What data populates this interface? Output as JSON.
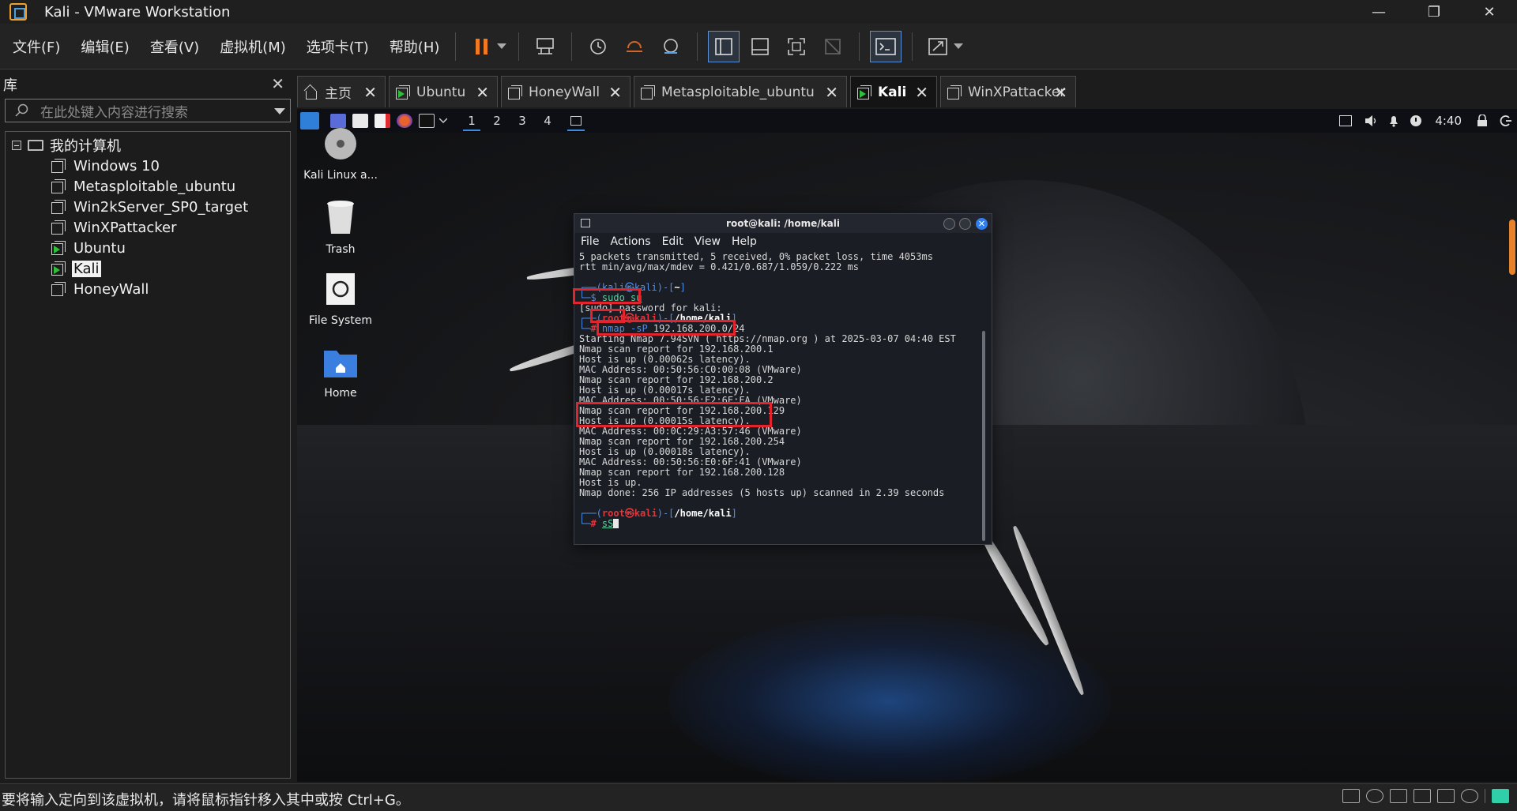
{
  "window": {
    "title": "Kali - VMware Workstation",
    "minimize": "—",
    "maximize": "❐",
    "close": "✕"
  },
  "menu": [
    "文件(F)",
    "编辑(E)",
    "查看(V)",
    "虚拟机(M)",
    "选项卡(T)",
    "帮助(H)"
  ],
  "toolbar_icons": [
    "pause-icon",
    "dropdown-arrow-icon",
    "send-ctrl-alt-del-icon",
    "snapshot-icon",
    "revert-snapshot-icon",
    "snapshot-manager-icon",
    "library-view-icon",
    "thumbnail-view-icon",
    "full-screen-icon",
    "unity-icon",
    "console-view-icon",
    "stretch-guest-icon"
  ],
  "library": {
    "title": "库",
    "close": "✕",
    "search_placeholder": "在此处键入内容进行搜索",
    "root": "我的计算机",
    "vms": [
      {
        "name": "Windows 10",
        "running": false,
        "selected": false
      },
      {
        "name": "Metasploitable_ubuntu",
        "running": false,
        "selected": false
      },
      {
        "name": "Win2kServer_SP0_target",
        "running": false,
        "selected": false
      },
      {
        "name": "WinXPattacker",
        "running": false,
        "selected": false
      },
      {
        "name": "Ubuntu",
        "running": true,
        "selected": false
      },
      {
        "name": "Kali",
        "running": true,
        "selected": true
      },
      {
        "name": "HoneyWall",
        "running": false,
        "selected": false
      }
    ]
  },
  "tabs": [
    {
      "label": "主页",
      "icon": "home-icon",
      "active": false
    },
    {
      "label": "Ubuntu",
      "icon": "vm-running-icon",
      "active": false
    },
    {
      "label": "HoneyWall",
      "icon": "vm-icon",
      "active": false
    },
    {
      "label": "Metasploitable_ubuntu",
      "icon": "vm-icon",
      "active": false
    },
    {
      "label": "Kali",
      "icon": "vm-running-icon",
      "active": true
    },
    {
      "label": "WinXPattacker",
      "icon": "vm-icon",
      "active": false
    }
  ],
  "kali_panel": {
    "workspaces": [
      "1",
      "2",
      "3",
      "4"
    ],
    "active_workspace": "1",
    "clock": "4:40"
  },
  "desktop_icons": [
    {
      "label": "Kali Linux a...",
      "icon": "disc-icon"
    },
    {
      "label": "Trash",
      "icon": "trash-icon"
    },
    {
      "label": "File System",
      "icon": "filesystem-icon"
    },
    {
      "label": "Home",
      "icon": "home-folder-icon"
    }
  ],
  "terminal": {
    "title": "root@kali: /home/kali",
    "menu": [
      "File",
      "Actions",
      "Edit",
      "View",
      "Help"
    ],
    "lines": {
      "l1": "5 packets transmitted, 5 received, 0% packet loss, time 4053ms",
      "l2": "rtt min/avg/max/mdev = 0.421/0.687/1.059/0.222 ms",
      "p1_user": "kali",
      "p1_at": "㉿",
      "p1_host": "kali",
      "p1_dir": "~",
      "cmd1": "sudo su",
      "l3": "[sudo] password for kali:",
      "p2_user": "root",
      "p2_host": "kali",
      "p2_dir": "/home/kali",
      "cmd2_a": "nmap -sP",
      "cmd2_b": " 192.168.200.0/24",
      "l4": "Starting Nmap 7.94SVN ( https://nmap.org ) at 2025-03-07 04:40 EST",
      "l5": "Nmap scan report for 192.168.200.1",
      "l6": "Host is up (0.00062s latency).",
      "l7": "MAC Address: 00:50:56:C0:00:08 (VMware)",
      "l8": "Nmap scan report for 192.168.200.2",
      "l9": "Host is up (0.00017s latency).",
      "l10": "MAC Address: 00:50:56:E2:6E:FA (VMware)",
      "l11": "Nmap scan report for 192.168.200.129",
      "l12": "Host is up (0.00015s latency).",
      "l13": "MAC Address: 00:0C:29:A3:57:46 (VMware)",
      "l14": "Nmap scan report for 192.168.200.254",
      "l15": "Host is up (0.00018s latency).",
      "l16": "MAC Address: 00:50:56:E0:6F:41 (VMware)",
      "l17": "Nmap scan report for 192.168.200.128",
      "l18": "Host is up.",
      "l19": "Nmap done: 256 IP addresses (5 hosts up) scanned in 2.39 seconds",
      "p3_user": "root",
      "p3_host": "kali",
      "p3_dir": "/home/kali",
      "cmd3": "sS"
    }
  },
  "status": {
    "text": "要将输入定向到该虚拟机，请将鼠标指针移入其中或按 Ctrl+G。"
  },
  "colors": {
    "highlight": "#e4242c",
    "kali_blue": "#4f8ee8",
    "root_red": "#e0353b",
    "running_green": "#2fbf3a",
    "pause_orange": "#f07a22"
  }
}
